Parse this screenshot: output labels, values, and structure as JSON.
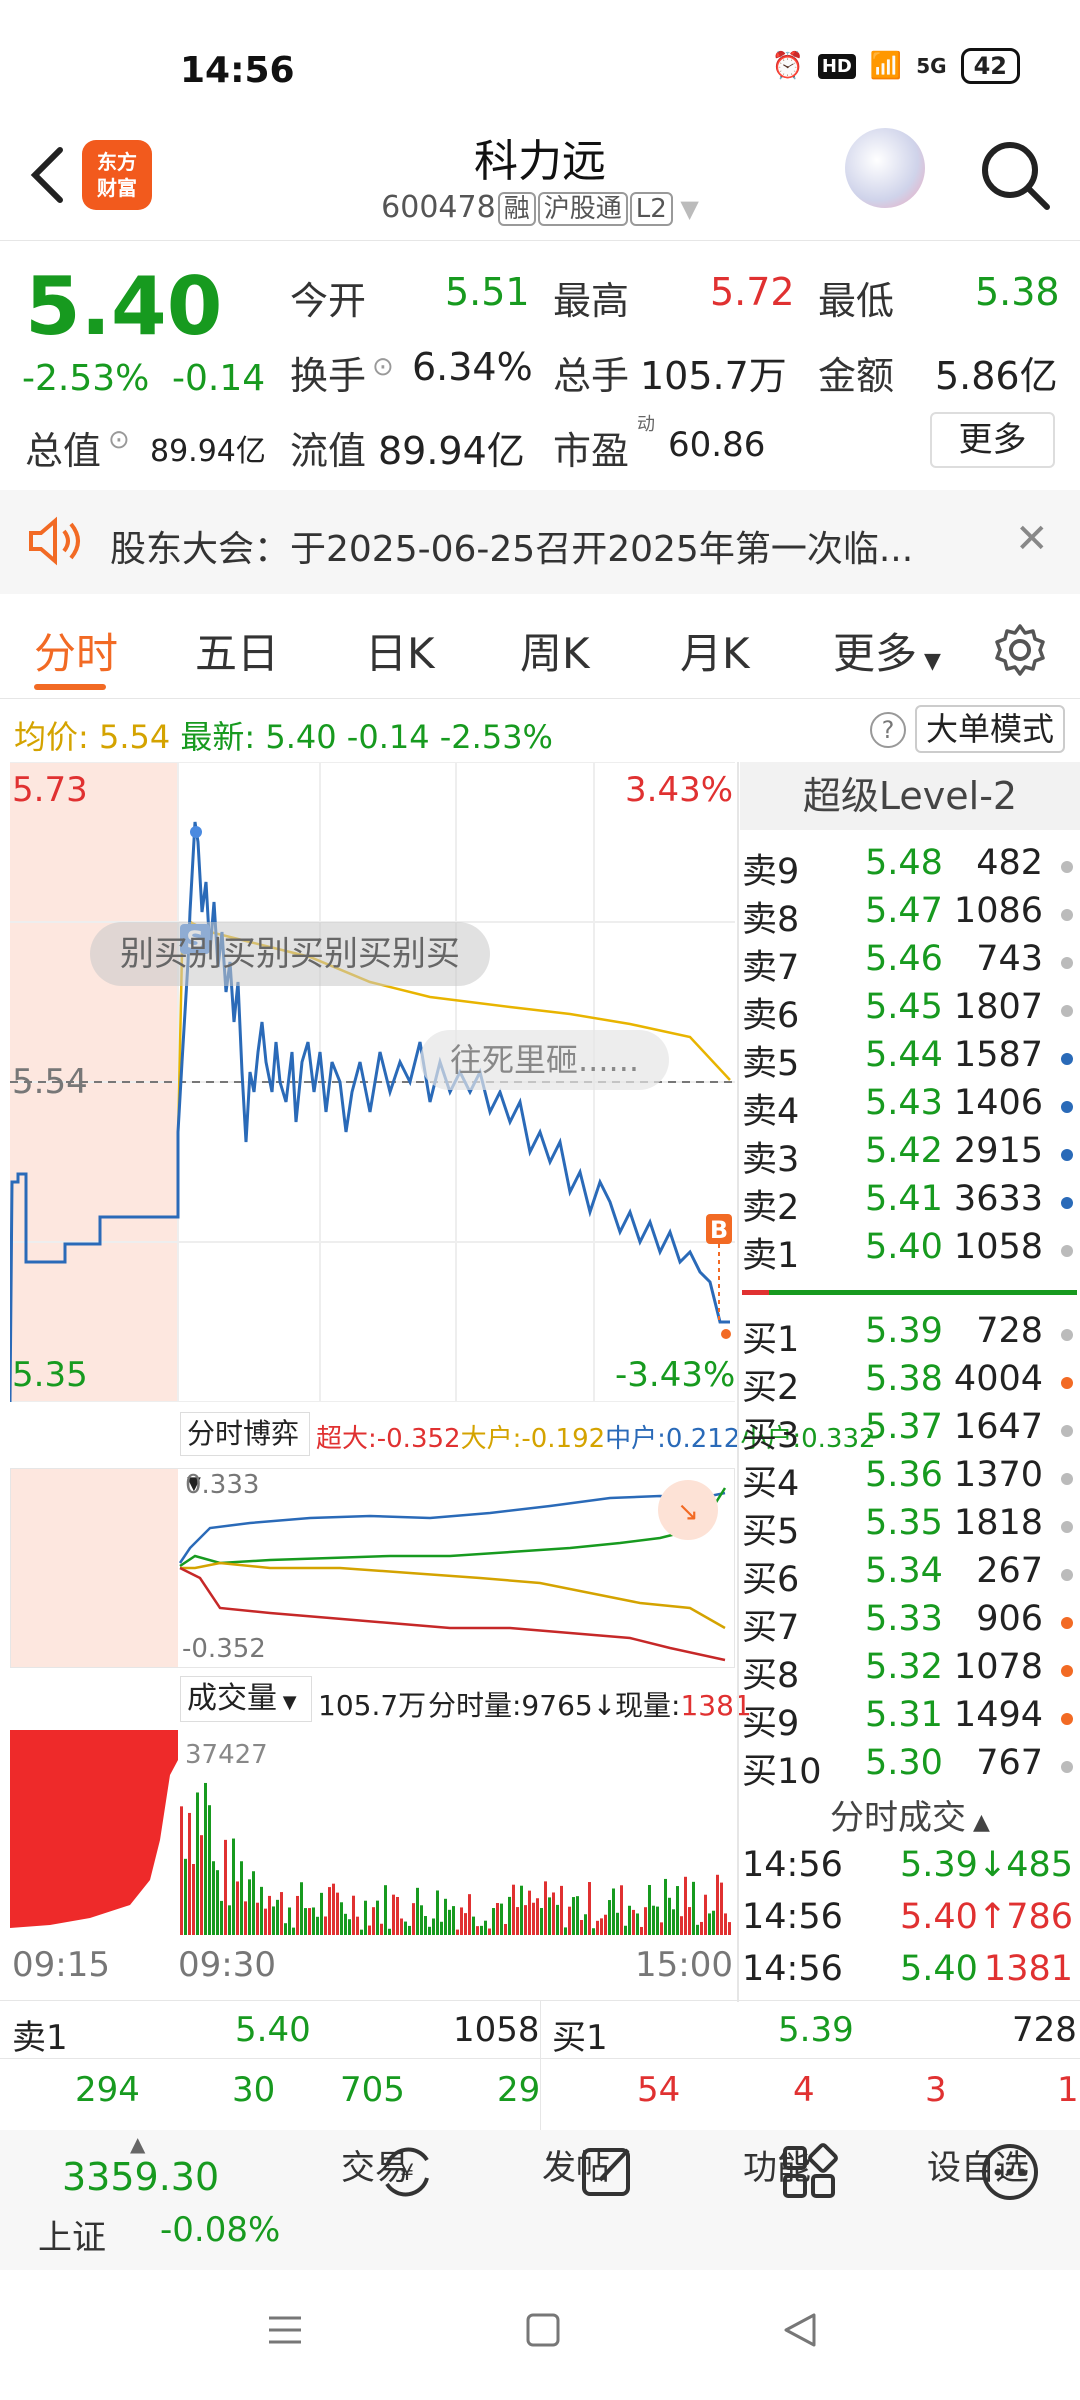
{
  "status": {
    "time": "14:56",
    "signal": "5G",
    "hd": "HD",
    "battery": "42"
  },
  "header": {
    "name": "科力远",
    "code": "600478",
    "tags": [
      "融",
      "沪股通",
      "L2"
    ],
    "logo": "东方财富"
  },
  "quote": {
    "price": "5.40",
    "change_pct": "-2.53%",
    "change_amt": "-0.14",
    "open_label": "今开",
    "open": "5.51",
    "high_label": "最高",
    "high": "5.72",
    "low_label": "最低",
    "low": "5.38",
    "turnover_label": "换手",
    "turnover": "6.34%",
    "vol_label": "总手",
    "vol": "105.7万",
    "amount_label": "金额",
    "amount": "5.86亿",
    "mcap_label": "总值",
    "mcap": "89.94亿",
    "float_label": "流值",
    "float": "89.94亿",
    "pe_label": "市盈",
    "pe_sup": "动",
    "pe": "60.86",
    "more": "更多"
  },
  "notice": {
    "text": "股东大会：于2025-06-25召开2025年第一次临..."
  },
  "tabs": [
    "分时",
    "五日",
    "日K",
    "周K",
    "月K",
    "更多"
  ],
  "info": {
    "avg_label": "均价:",
    "avg": "5.54",
    "latest_label": "最新:",
    "latest": "5.40",
    "chg": "-0.14",
    "pct": "-2.53%",
    "bigmode": "大单模式"
  },
  "chart": {
    "top_price": "5.73",
    "top_pct": "3.43%",
    "mid_price": "5.54",
    "bot_price": "5.35",
    "bot_pct": "-3.43%",
    "comment1": "别买别买别买别买别买",
    "comment2": "往死里砸......",
    "marker_s": "S",
    "marker_b": "B",
    "flow_label": "分时博弈",
    "flow": {
      "super": "超大:-0.352",
      "big": "大户:-0.192",
      "mid": "中户:0.212",
      "small": "小户:0.332"
    },
    "flow_top": "0.333",
    "flow_bot": "-0.352",
    "vol_label": "成交量",
    "vol_total": "105.7万",
    "vol_min": "分时量:9765↓",
    "vol_now_label": "现量:",
    "vol_now": "1381",
    "vol_max": "37427",
    "time_start": "09:15",
    "time_open": "09:30",
    "time_end": "15:00"
  },
  "orderbook": {
    "title": "超级Level-2",
    "asks": [
      {
        "label": "卖9",
        "price": "5.48",
        "vol": "482",
        "dot": "#bbbbbb"
      },
      {
        "label": "卖8",
        "price": "5.47",
        "vol": "1086",
        "dot": "#bbbbbb"
      },
      {
        "label": "卖7",
        "price": "5.46",
        "vol": "743",
        "dot": "#bbbbbb"
      },
      {
        "label": "卖6",
        "price": "5.45",
        "vol": "1807",
        "dot": "#bbbbbb"
      },
      {
        "label": "卖5",
        "price": "5.44",
        "vol": "1587",
        "dot": "#2a6ab8"
      },
      {
        "label": "卖4",
        "price": "5.43",
        "vol": "1406",
        "dot": "#2a6ab8"
      },
      {
        "label": "卖3",
        "price": "5.42",
        "vol": "2915",
        "dot": "#2a6ab8"
      },
      {
        "label": "卖2",
        "price": "5.41",
        "vol": "3633",
        "dot": "#2a6ab8"
      },
      {
        "label": "卖1",
        "price": "5.40",
        "vol": "1058",
        "dot": "#bbbbbb"
      }
    ],
    "bids": [
      {
        "label": "买1",
        "price": "5.39",
        "vol": "728",
        "dot": "#bbbbbb"
      },
      {
        "label": "买2",
        "price": "5.38",
        "vol": "4004",
        "dot": "#f26a24"
      },
      {
        "label": "买3",
        "price": "5.37",
        "vol": "1647",
        "dot": "#bbbbbb"
      },
      {
        "label": "买4",
        "price": "5.36",
        "vol": "1370",
        "dot": "#bbbbbb"
      },
      {
        "label": "买5",
        "price": "5.35",
        "vol": "1818",
        "dot": "#bbbbbb"
      },
      {
        "label": "买6",
        "price": "5.34",
        "vol": "267",
        "dot": "#bbbbbb"
      },
      {
        "label": "买7",
        "price": "5.33",
        "vol": "906",
        "dot": "#f26a24"
      },
      {
        "label": "买8",
        "price": "5.32",
        "vol": "1078",
        "dot": "#f26a24"
      },
      {
        "label": "买9",
        "price": "5.31",
        "vol": "1494",
        "dot": "#f26a24"
      },
      {
        "label": "买10",
        "price": "5.30",
        "vol": "767",
        "dot": "#bbbbbb"
      }
    ],
    "trades_title": "分时成交",
    "trades": [
      {
        "time": "14:56",
        "price": "5.39↓",
        "vol": "485"
      },
      {
        "time": "14:56",
        "price": "5.40↑",
        "vol": "786"
      },
      {
        "time": "14:56",
        "price": "5.40",
        "vol": "1381"
      }
    ]
  },
  "summary": {
    "sell_label": "卖1",
    "sell_price": "5.40",
    "sell_vol": "1058",
    "buy_label": "买1",
    "buy_price": "5.39",
    "buy_vol": "728",
    "sell_split": [
      "294",
      "30",
      "705",
      "29"
    ],
    "buy_split": [
      "54",
      "4",
      "3",
      "1"
    ]
  },
  "bottom_nav": {
    "index_value": "3359.30",
    "index_name": "上证",
    "index_chg": "-0.08%",
    "items": [
      "交易",
      "发帖",
      "功能",
      "设自选"
    ]
  }
}
